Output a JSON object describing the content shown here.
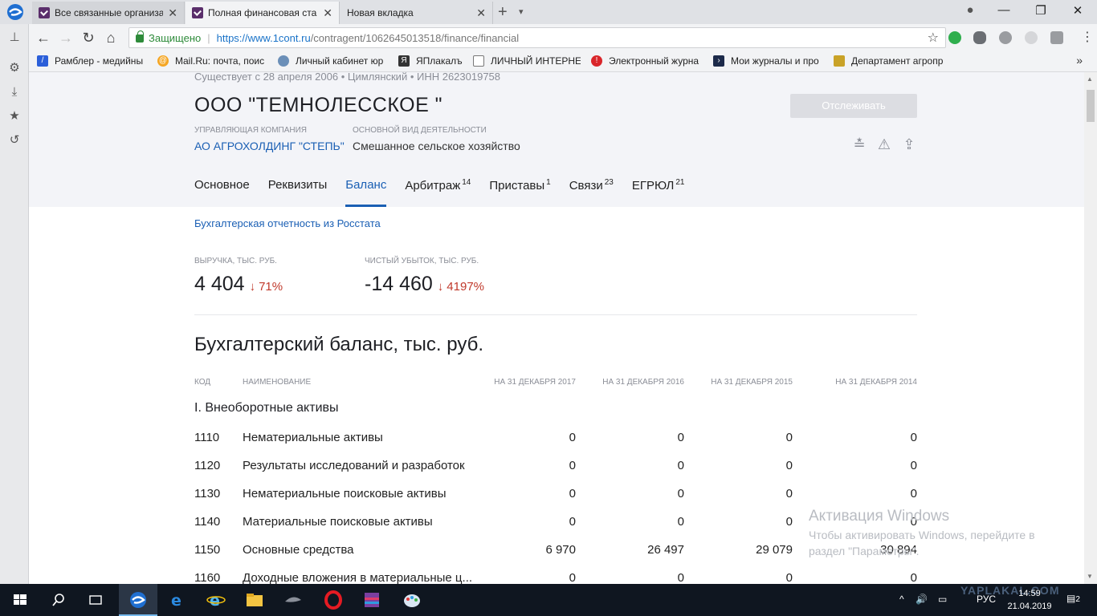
{
  "browser": {
    "tabs": [
      {
        "title": "Все связанные организа",
        "active": false
      },
      {
        "title": "Полная финансовая ста",
        "active": true
      },
      {
        "title": "Новая вкладка",
        "active": false
      }
    ],
    "new_tab_symbol": "+",
    "tab_menu_symbol": "▾",
    "window": {
      "account": "●",
      "minimize": "—",
      "restore": "❐",
      "close": "✕"
    },
    "secure_label": "Защищено",
    "url_host": "https://www.1cont.ru",
    "url_path": "/contragent/1062645013518/finance/financial",
    "bookmarks": [
      "Рамблер - медийны",
      "Mail.Ru: почта, поис",
      "Личный кабинет юр",
      "ЯПлакалъ",
      "ЛИЧНЫЙ ИНТЕРНЕТ",
      "Электронный журна",
      "Мои журналы и про",
      "Департамент агропр"
    ],
    "bookmarks_more": "»"
  },
  "company": {
    "exists": "Существует с 28 апреля 2006 • Цимлянский • ИНН 2623019758",
    "name": "ООО \"ТЕМНОЛЕССКОЕ \"",
    "follow_button": "Отслеживать",
    "management_label": "УПРАВЛЯЮЩАЯ КОМПАНИЯ",
    "management_value": "АО АГРОХОЛДИНГ \"СТЕПЬ\"",
    "activity_label": "ОСНОВНОЙ ВИД ДЕЯТЕЛЬНОСТИ",
    "activity_value": "Смешанное сельское хозяйство"
  },
  "nav": [
    {
      "label": "Основное",
      "count": "",
      "active": false
    },
    {
      "label": "Реквизиты",
      "count": "",
      "active": false
    },
    {
      "label": "Баланс",
      "count": "",
      "active": true
    },
    {
      "label": "Арбитраж",
      "count": "14",
      "active": false
    },
    {
      "label": "Приставы",
      "count": "1",
      "active": false
    },
    {
      "label": "Связи",
      "count": "23",
      "active": false
    },
    {
      "label": "ЕГРЮЛ",
      "count": "21",
      "active": false
    }
  ],
  "finance": {
    "rosstat_link": "Бухгалтерская отчетность из Росстата",
    "revenue_label": "ВЫРУЧКА, ТЫС. РУБ.",
    "revenue_value": "4 404",
    "revenue_delta": "71%",
    "loss_label": "ЧИСТЫЙ УБЫТОК, ТЫС. РУБ.",
    "loss_value": "-14 460",
    "loss_delta": "4197%",
    "arrow": "↓",
    "section_title": "Бухгалтерский баланс, тыс. руб.",
    "columns": [
      "КОД",
      "НАИМЕНОВАНИЕ",
      "НА 31 ДЕКАБРЯ 2017",
      "НА 31 ДЕКАБРЯ 2016",
      "НА 31 ДЕКАБРЯ 2015",
      "НА 31 ДЕКАБРЯ 2014"
    ],
    "group_title": "I. Внеоборотные активы",
    "rows": [
      {
        "code": "1110",
        "name": "Нематериальные активы",
        "v2017": "0",
        "v2016": "0",
        "v2015": "0",
        "v2014": "0"
      },
      {
        "code": "1120",
        "name": "Результаты исследований и разработок",
        "v2017": "0",
        "v2016": "0",
        "v2015": "0",
        "v2014": "0"
      },
      {
        "code": "1130",
        "name": "Нематериальные поисковые активы",
        "v2017": "0",
        "v2016": "0",
        "v2015": "0",
        "v2014": "0"
      },
      {
        "code": "1140",
        "name": "Материальные поисковые активы",
        "v2017": "0",
        "v2016": "0",
        "v2015": "0",
        "v2014": "0"
      },
      {
        "code": "1150",
        "name": "Основные средства",
        "v2017": "6 970",
        "v2016": "26 497",
        "v2015": "29 079",
        "v2014": "30 894"
      },
      {
        "code": "1160",
        "name": "Доходные вложения в материальные ц...",
        "v2017": "0",
        "v2016": "0",
        "v2015": "0",
        "v2014": "0"
      }
    ]
  },
  "watermark": {
    "title": "Активация Windows",
    "subtitle": "Чтобы активировать Windows, перейдите в раздел \"Параметры\"."
  },
  "taskbar": {
    "lang": "РУС",
    "time": "14:59",
    "date": "21.04.2019",
    "notifications": "2",
    "yaplakal_mark": "YAPLAKAL.COM"
  },
  "colors": {
    "accent": "#1a5fb4",
    "negative": "#c0392b",
    "secure": "#2e8b3a",
    "header_bg": "#f3f4f8"
  }
}
